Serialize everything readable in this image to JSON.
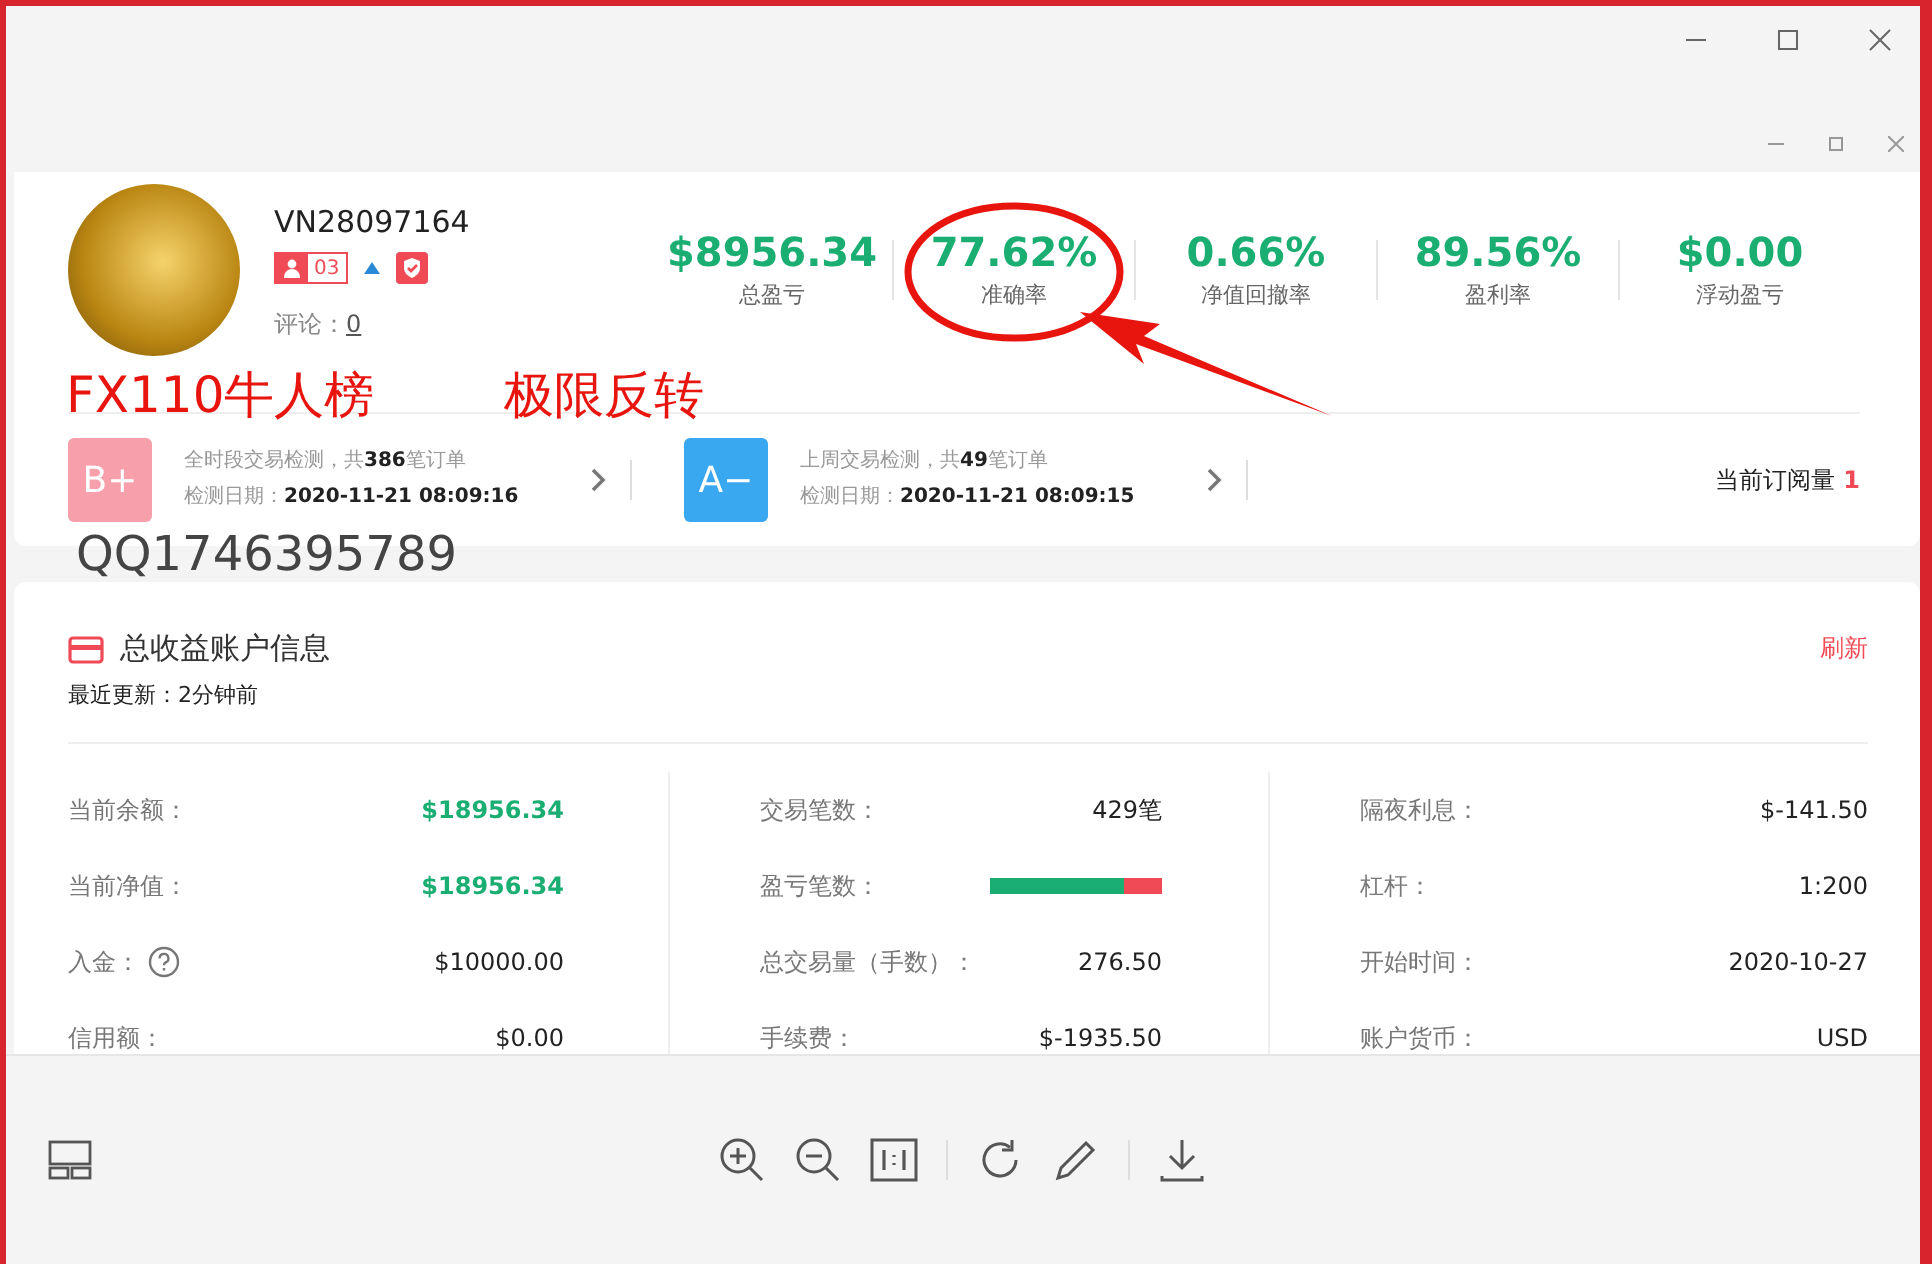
{
  "account": {
    "name": "VN28097164",
    "badge_count": "03",
    "comments_label": "评论：",
    "comments_count": "0"
  },
  "stats": [
    {
      "value": "$8956.34",
      "label": "总盈亏",
      "circled": false
    },
    {
      "value": "77.62%",
      "label": "准确率",
      "circled": true
    },
    {
      "value": "0.66%",
      "label": "净值回撤率",
      "circled": false
    },
    {
      "value": "89.56%",
      "label": "盈利率",
      "circled": false
    },
    {
      "value": "$0.00",
      "label": "浮动盈亏",
      "circled": false
    }
  ],
  "annotations": {
    "labels": [
      "FX110牛人榜",
      "极限反转"
    ],
    "qq": "QQ1746395789"
  },
  "ratings": [
    {
      "grade": "B+",
      "color": "#f7a0ac",
      "summary": "全时段交易检测，共**386**笔订单",
      "date_label": "检测日期：",
      "date": "2020-11-21 08:09:16"
    },
    {
      "grade": "A−",
      "color": "#3aa8f0",
      "summary": "上周交易检测，共**49**笔订单",
      "date_label": "检测日期：",
      "date": "2020-11-21 08:09:15"
    }
  ],
  "subscriptions": {
    "label": "当前订阅量",
    "count": "1"
  },
  "info": {
    "title": "总收益账户信息",
    "refresh": "刷新",
    "updated": "最近更新：2分钟前",
    "columns": [
      [
        {
          "kind": "highlight",
          "label": "当前余额：",
          "value": "$18956.34"
        },
        {
          "kind": "highlight",
          "label": "当前净值：",
          "value": "$18956.34"
        },
        {
          "kind": "help",
          "label": "入金：",
          "value": "$10000.00"
        },
        {
          "kind": "plain",
          "label": "信用额：",
          "value": "$0.00"
        }
      ],
      [
        {
          "kind": "plain",
          "label": "交易笔数：",
          "value": "429笔"
        },
        {
          "kind": "bar",
          "label": "盈亏笔数：",
          "level": 0.78
        },
        {
          "kind": "plain",
          "label": "总交易量（手数）：",
          "value": "276.50"
        },
        {
          "kind": "plain",
          "label": "手续费：",
          "value": "$-1935.50"
        }
      ],
      [
        {
          "kind": "plain",
          "label": "隔夜利息：",
          "value": "$-141.50"
        },
        {
          "kind": "plain",
          "label": "杠杆：",
          "value": "1:200"
        },
        {
          "kind": "plain",
          "label": "开始时间：",
          "value": "2020-10-27"
        },
        {
          "kind": "plain",
          "label": "账户货币：",
          "value": "USD"
        }
      ]
    ]
  }
}
